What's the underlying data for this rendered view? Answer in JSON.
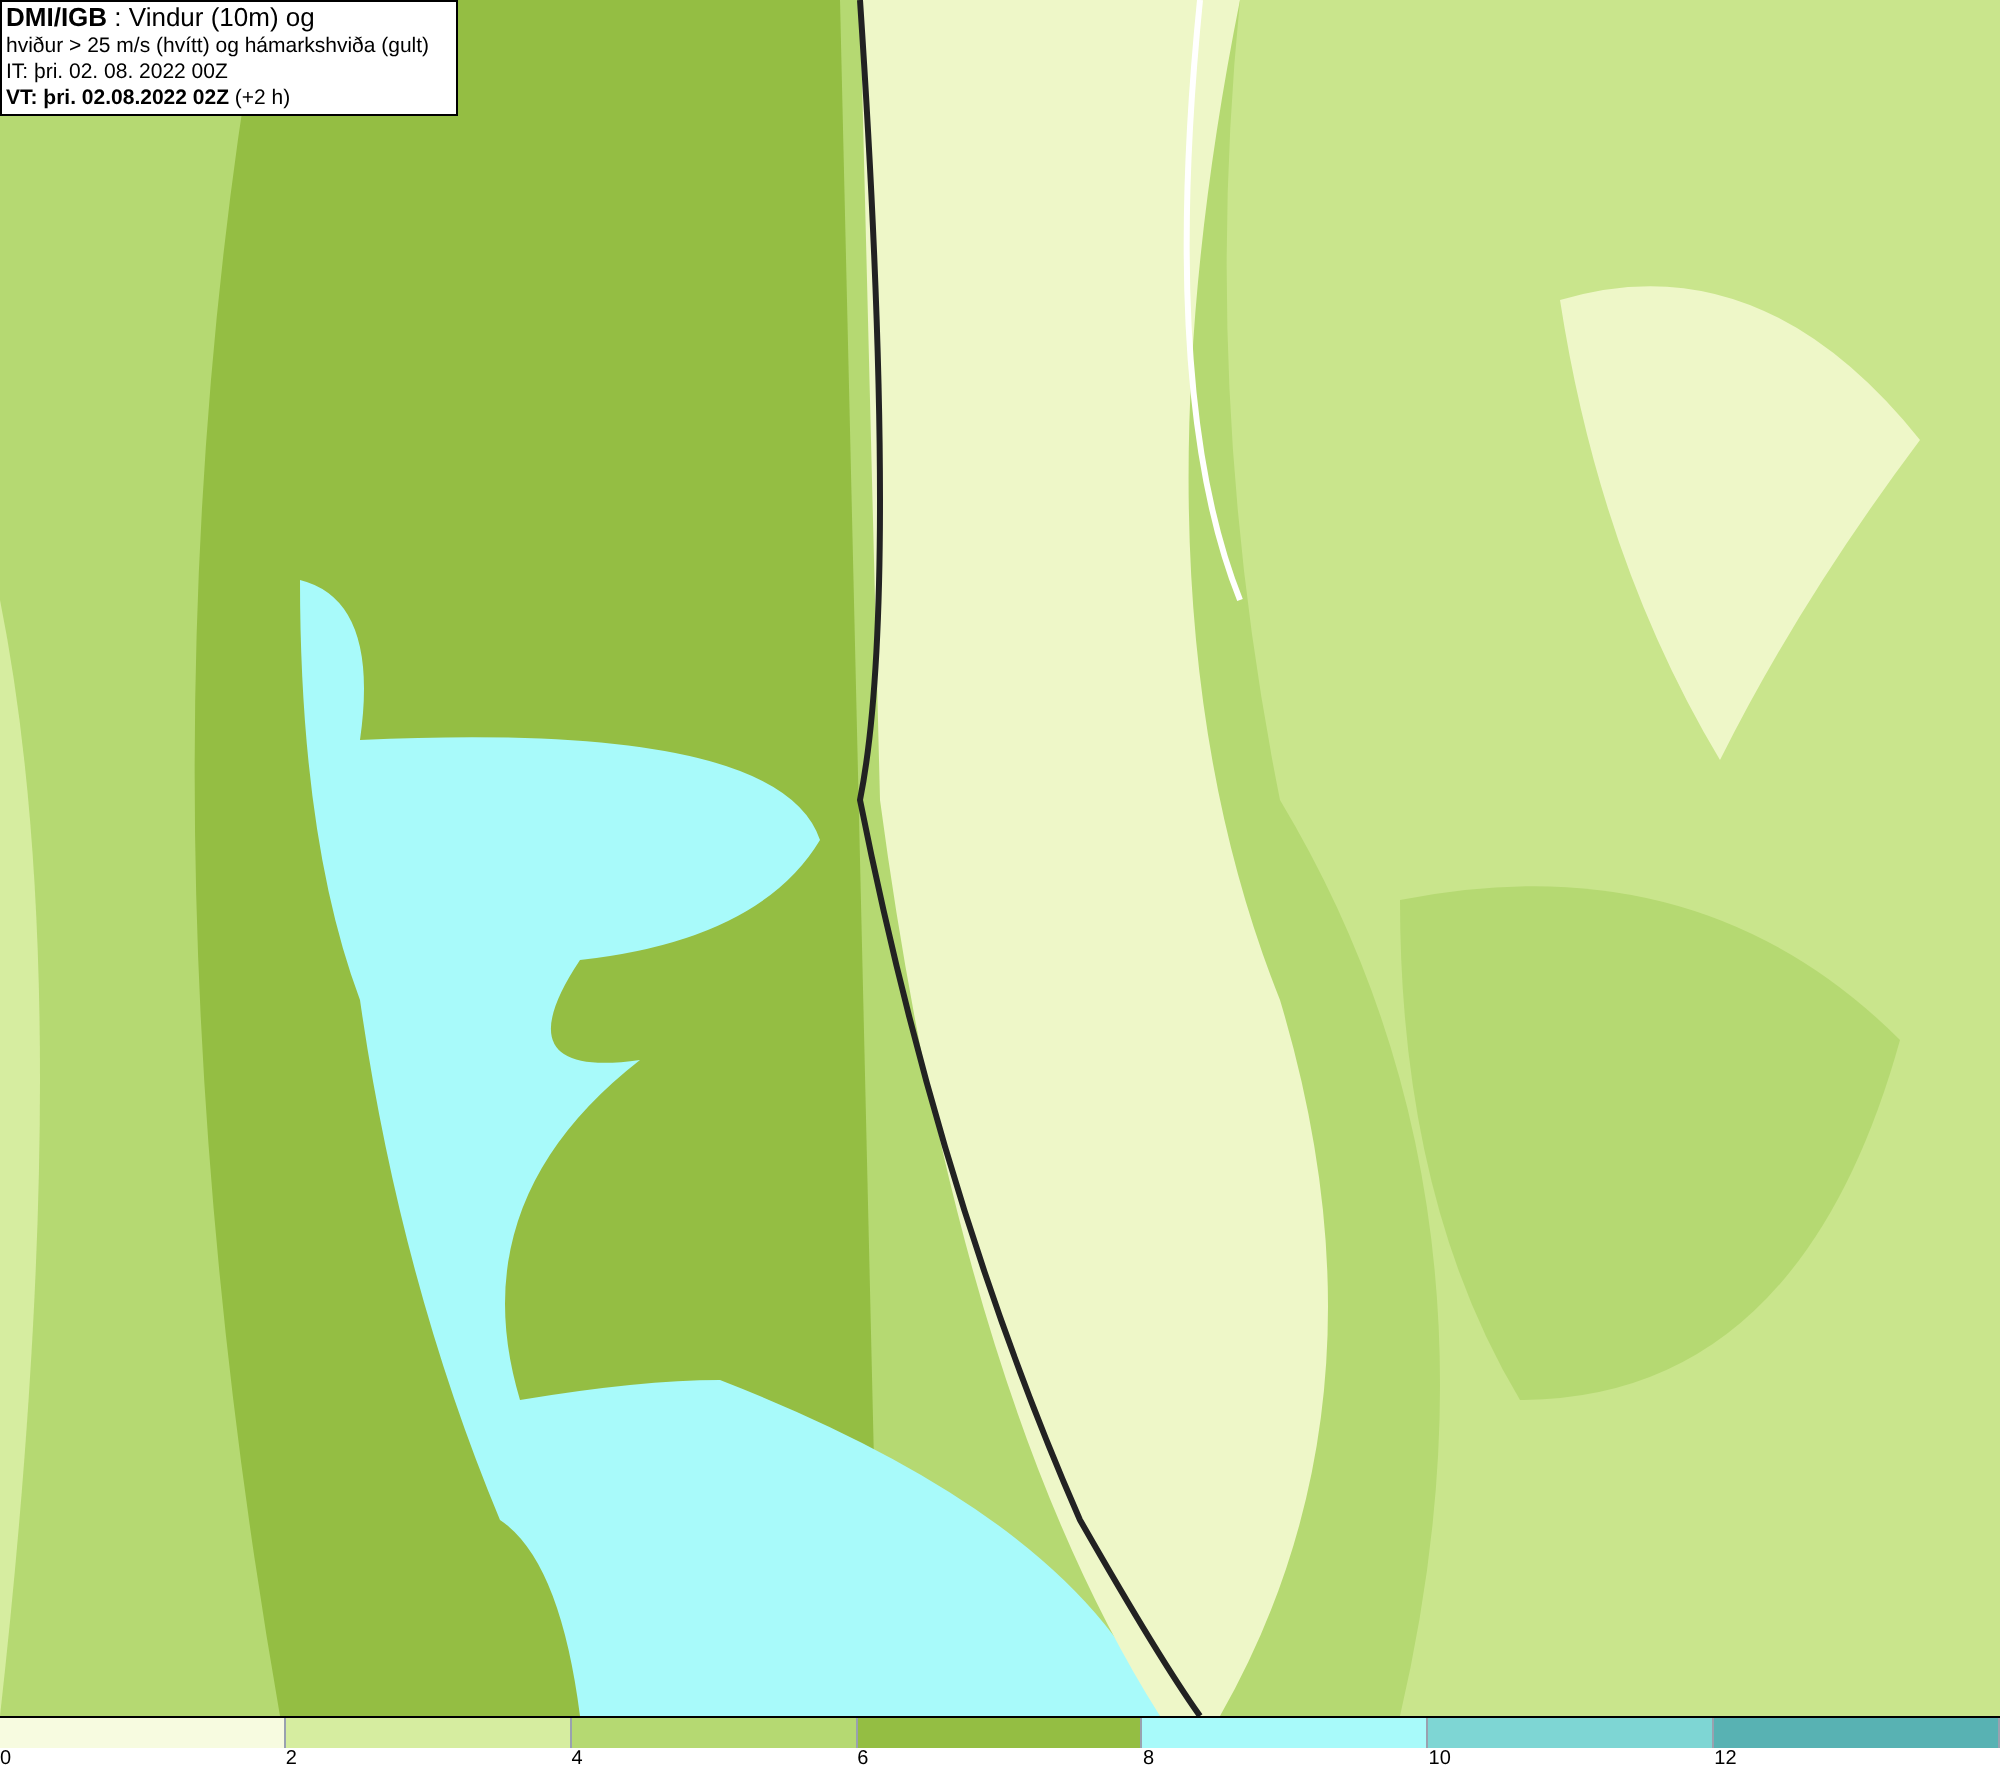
{
  "header": {
    "lines": [
      "**DMI/IGB** : Vindur (10m) og",
      "hviður > 25 m/s (hvítt) og hámarkshviða (gult)",
      "IT: þri. 02. 08. 2022 00Z",
      "**VT: þri. 02.08.2022 02Z** (+2 h)"
    ]
  },
  "legend": [
    {
      "label": "0",
      "color": "#f7fbe0"
    },
    {
      "label": "2",
      "color": "#d6eda0"
    },
    {
      "label": "4",
      "color": "#b5d972"
    },
    {
      "label": "6",
      "color": "#94be43"
    },
    {
      "label": "8",
      "color": "#a8fafa"
    },
    {
      "label": "10",
      "color": "#7ed6d4"
    },
    {
      "label": "12",
      "color": "#58b2b3"
    }
  ]
}
